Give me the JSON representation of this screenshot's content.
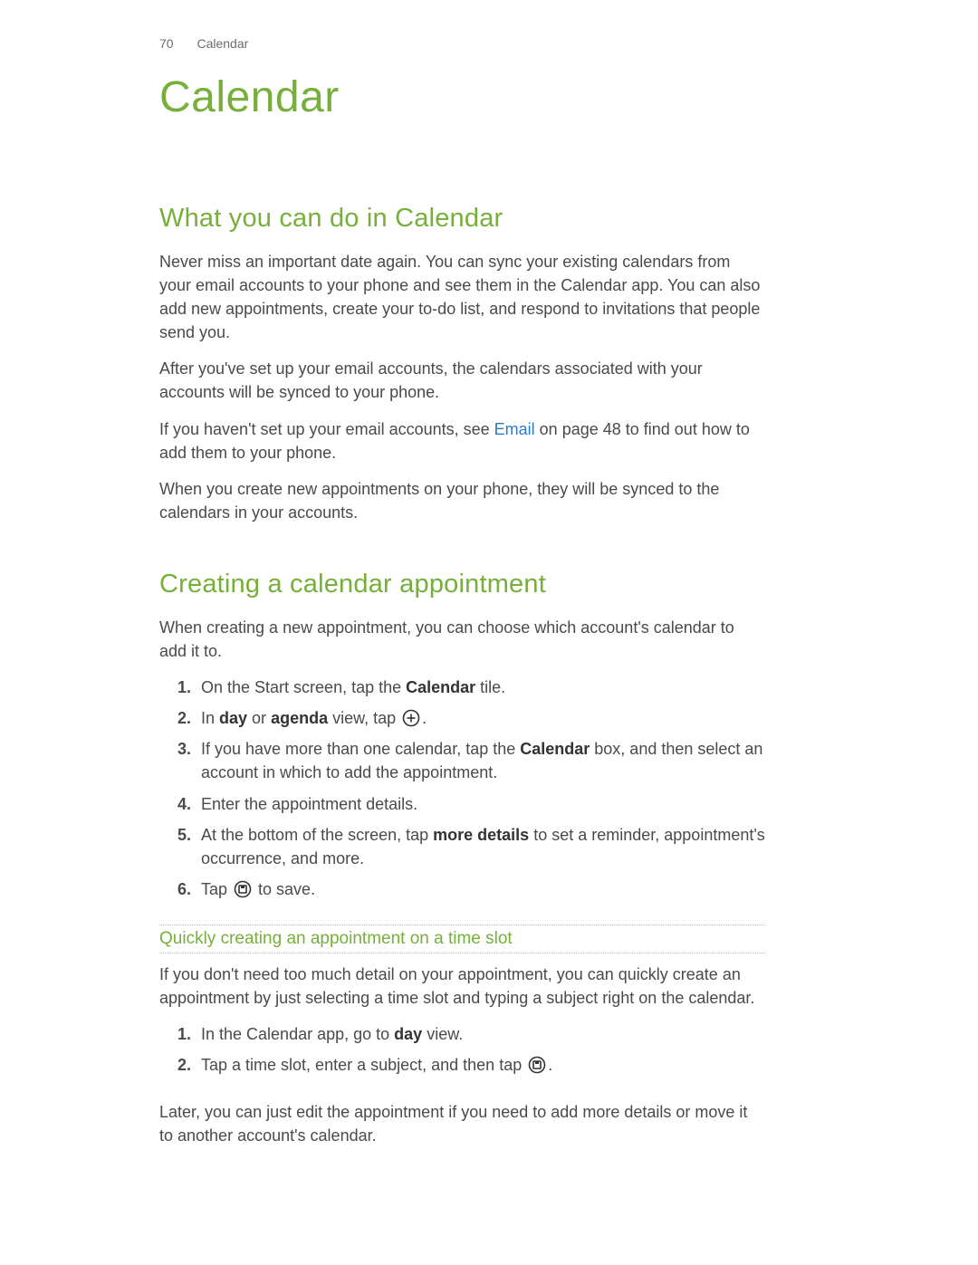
{
  "header": {
    "page_number": "70",
    "section": "Calendar"
  },
  "title": "Calendar",
  "section1": {
    "heading": "What you can do in Calendar",
    "p1": "Never miss an important date again. You can sync your existing calendars from your email accounts to your phone and see them in the Calendar app. You can also add new appointments, create your to-do list, and respond to invitations that people send you.",
    "p2": "After you've set up your email accounts, the calendars associated with your accounts will be synced to your phone.",
    "p3_a": "If you haven't set up your email accounts, see ",
    "p3_link": "Email",
    "p3_b": " on page 48 to find out how to add them to your phone.",
    "p4": "When you create new appointments on your phone, they will be synced to the calendars in your accounts."
  },
  "section2": {
    "heading": "Creating a calendar appointment",
    "intro": "When creating a new appointment, you can choose which account's calendar to add it to.",
    "steps": {
      "s1_a": "On the Start screen, tap the ",
      "s1_b": "Calendar",
      "s1_c": " tile.",
      "s2_a": "In ",
      "s2_b": "day",
      "s2_c": " or ",
      "s2_d": "agenda",
      "s2_e": " view, tap ",
      "s2_f": ".",
      "s3_a": "If you have more than one calendar, tap the ",
      "s3_b": "Calendar",
      "s3_c": " box, and then select an account in which to add the appointment.",
      "s4": "Enter the appointment details.",
      "s5_a": "At the bottom of the screen, tap ",
      "s5_b": "more details",
      "s5_c": " to set a reminder, appointment's occurrence, and more.",
      "s6_a": "Tap ",
      "s6_b": " to save."
    },
    "sub": {
      "heading": "Quickly creating an appointment on a time slot",
      "p1": "If you don't need too much detail on your appointment, you can quickly create an appointment by just selecting a time slot and typing a subject right on the calendar.",
      "steps": {
        "s1_a": "In the Calendar app, go to ",
        "s1_b": "day",
        "s1_c": " view.",
        "s2_a": "Tap a time slot, enter a subject, and then tap ",
        "s2_b": "."
      },
      "p2": "Later, you can just edit the appointment if you need to add more details or move it to another account's calendar."
    }
  }
}
